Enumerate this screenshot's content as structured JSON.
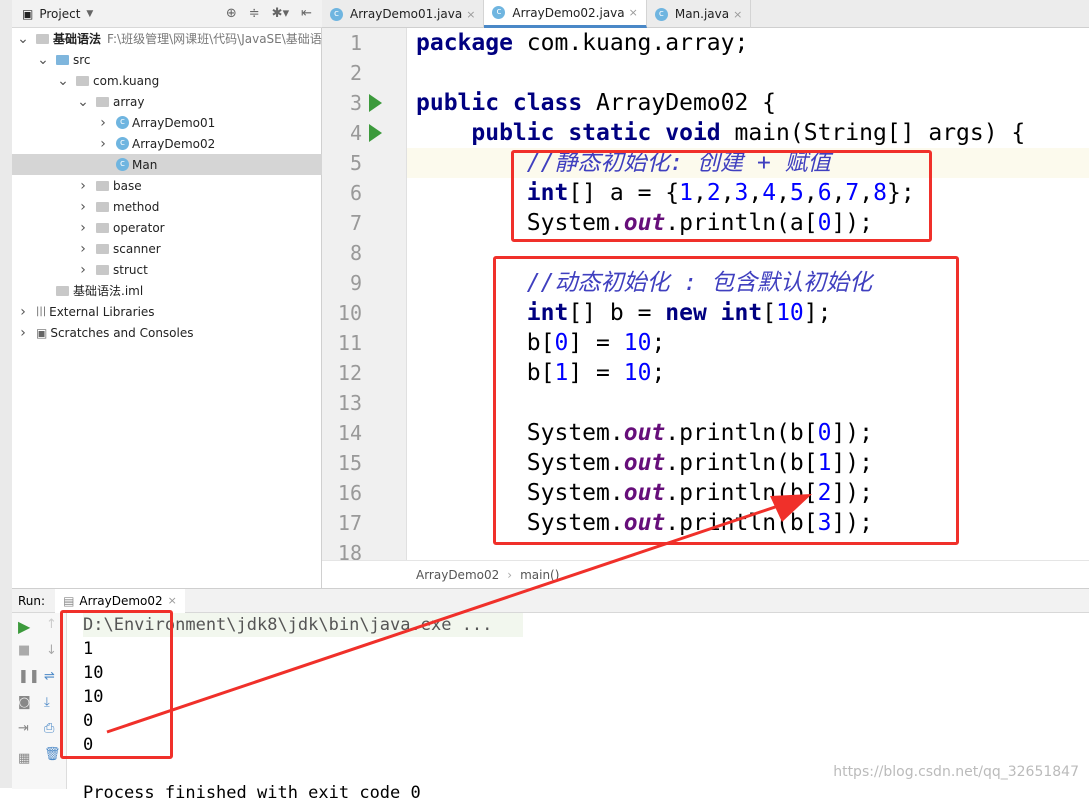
{
  "project_panel": {
    "title": "Project",
    "tree": [
      {
        "label": "基础语法",
        "path": "F:\\班级管理\\网课班\\代码\\JavaSE\\基础语",
        "level": 0,
        "arrow": "v",
        "icon": "module"
      },
      {
        "label": "src",
        "level": 1,
        "arrow": "v",
        "icon": "folder-blue"
      },
      {
        "label": "com.kuang",
        "level": 2,
        "arrow": "v",
        "icon": "package"
      },
      {
        "label": "array",
        "level": 3,
        "arrow": "v",
        "icon": "package"
      },
      {
        "label": "ArrayDemo01",
        "level": 4,
        "arrow": ">",
        "icon": "class"
      },
      {
        "label": "ArrayDemo02",
        "level": 4,
        "arrow": ">",
        "icon": "class"
      },
      {
        "label": "Man",
        "level": 4,
        "arrow": "",
        "icon": "class",
        "selected": true
      },
      {
        "label": "base",
        "level": 3,
        "arrow": ">",
        "icon": "package"
      },
      {
        "label": "method",
        "level": 3,
        "arrow": ">",
        "icon": "package"
      },
      {
        "label": "operator",
        "level": 3,
        "arrow": ">",
        "icon": "package"
      },
      {
        "label": "scanner",
        "level": 3,
        "arrow": ">",
        "icon": "package"
      },
      {
        "label": "struct",
        "level": 3,
        "arrow": ">",
        "icon": "package"
      },
      {
        "label": "基础语法.iml",
        "level": 1,
        "arrow": "",
        "icon": "file"
      },
      {
        "label": "External Libraries",
        "level": 0,
        "arrow": ">",
        "icon": "library"
      },
      {
        "label": "Scratches and Consoles",
        "level": 0,
        "arrow": ">",
        "icon": "scratch"
      }
    ]
  },
  "tabs": [
    {
      "label": "ArrayDemo01.java",
      "active": false
    },
    {
      "label": "ArrayDemo02.java",
      "active": true
    },
    {
      "label": "Man.java",
      "active": false
    }
  ],
  "editor": {
    "lines": [
      "<span class=\"kw\">package</span> com.kuang.array;",
      "",
      "<span class=\"kw\">public class</span> ArrayDemo02 {",
      "    <span class=\"kw\">public static void</span> main(String[] args) {",
      "        <span class=\"cm\">//静态初始化: 创建 + 赋值</span>",
      "        <span class=\"kw\">int</span>[] a = {<span class=\"num\">1</span>,<span class=\"num\">2</span>,<span class=\"num\">3</span>,<span class=\"num\">4</span>,<span class=\"num\">5</span>,<span class=\"num\">6</span>,<span class=\"num\">7</span>,<span class=\"num\">8</span>};",
      "        System.<span class=\"st\">out</span>.println(a[<span class=\"num\">0</span>]);",
      "",
      "        <span class=\"cm\">//动态初始化 : 包含默认初始化</span>",
      "        <span class=\"kw\">int</span>[] b = <span class=\"kw\">new int</span>[<span class=\"num\">10</span>];",
      "        b[<span class=\"num\">0</span>] = <span class=\"num\">10</span>;",
      "        b[<span class=\"num\">1</span>] = <span class=\"num\">10</span>;",
      "",
      "        System.<span class=\"st\">out</span>.println(b[<span class=\"num\">0</span>]);",
      "        System.<span class=\"st\">out</span>.println(b[<span class=\"num\">1</span>]);",
      "        System.<span class=\"st\">out</span>.println(b[<span class=\"num\">2</span>]);",
      "        System.<span class=\"st\">out</span>.println(b[<span class=\"num\">3</span>]);",
      ""
    ],
    "run_gutter_lines": [
      3,
      4
    ],
    "highlighted_line": 5
  },
  "breadcrumb": [
    "ArrayDemo02",
    "main()"
  ],
  "run": {
    "label": "Run:",
    "tab": "ArrayDemo02",
    "output": [
      "D:\\Environment\\jdk8\\jdk\\bin\\java.exe ...",
      "1",
      "10",
      "10",
      "0",
      "0",
      "",
      "Process finished with exit code 0"
    ]
  },
  "watermark": "https://blog.csdn.net/qq_32651847",
  "colors": {
    "annotation": "#f0302a",
    "keyword": "#000080",
    "number": "#0000ff",
    "comment": "#3f3fbf"
  }
}
